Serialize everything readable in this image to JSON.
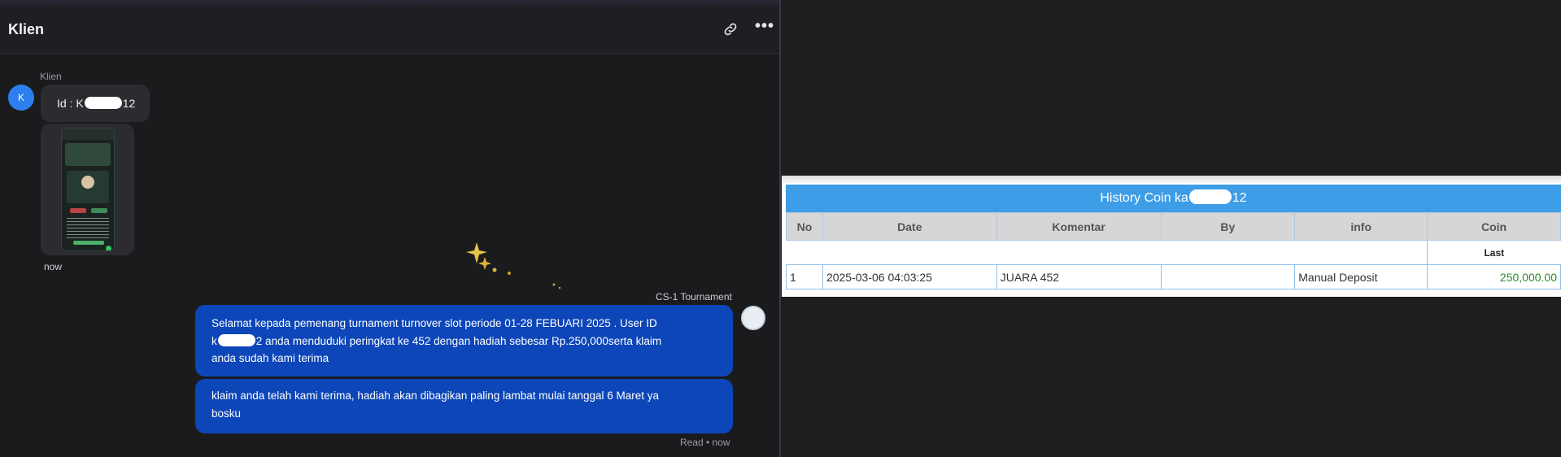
{
  "chat": {
    "title": "Klien",
    "sender_name": "Klien",
    "avatar_letter": "K",
    "message_in_prefix": "Id : K",
    "message_in_suffix": "12",
    "time_in": "now",
    "sender_out": "CS-1 Tournament",
    "bubble1_line1": "Selamat kepada pemenang turnament turnover slot periode 01-28 FEBUARI 2025 . User ID",
    "bubble1_line2_prefix": "k",
    "bubble1_line2_suffix": "2 anda menduduki peringkat ke 452 dengan hadiah sebesar Rp.250,000serta klaim",
    "bubble1_line3": "anda sudah kami terima",
    "bubble2_line1": "klaim anda telah kami terima, hadiah akan dibagikan paling lambat mulai tanggal 6 Maret ya",
    "bubble2_line2": "bosku",
    "read_status": "Read • now",
    "icons": {
      "link": "link-icon",
      "more": "more-icon",
      "sparkles": "sparkles-icon"
    }
  },
  "history": {
    "title_prefix": "History Coin ka",
    "title_suffix": "12",
    "columns": [
      "No",
      "Date",
      "Komentar",
      "By",
      "info",
      "Coin"
    ],
    "sub_label": "Last",
    "rows": [
      {
        "no": "1",
        "date": "2025-03-06 04:03:25",
        "komentar": "JUARA 452",
        "by": "",
        "info": "Manual Deposit",
        "coin": "250,000.00"
      }
    ],
    "colors": {
      "header": "#3d9de6",
      "coin": "#2b8a2b"
    }
  }
}
